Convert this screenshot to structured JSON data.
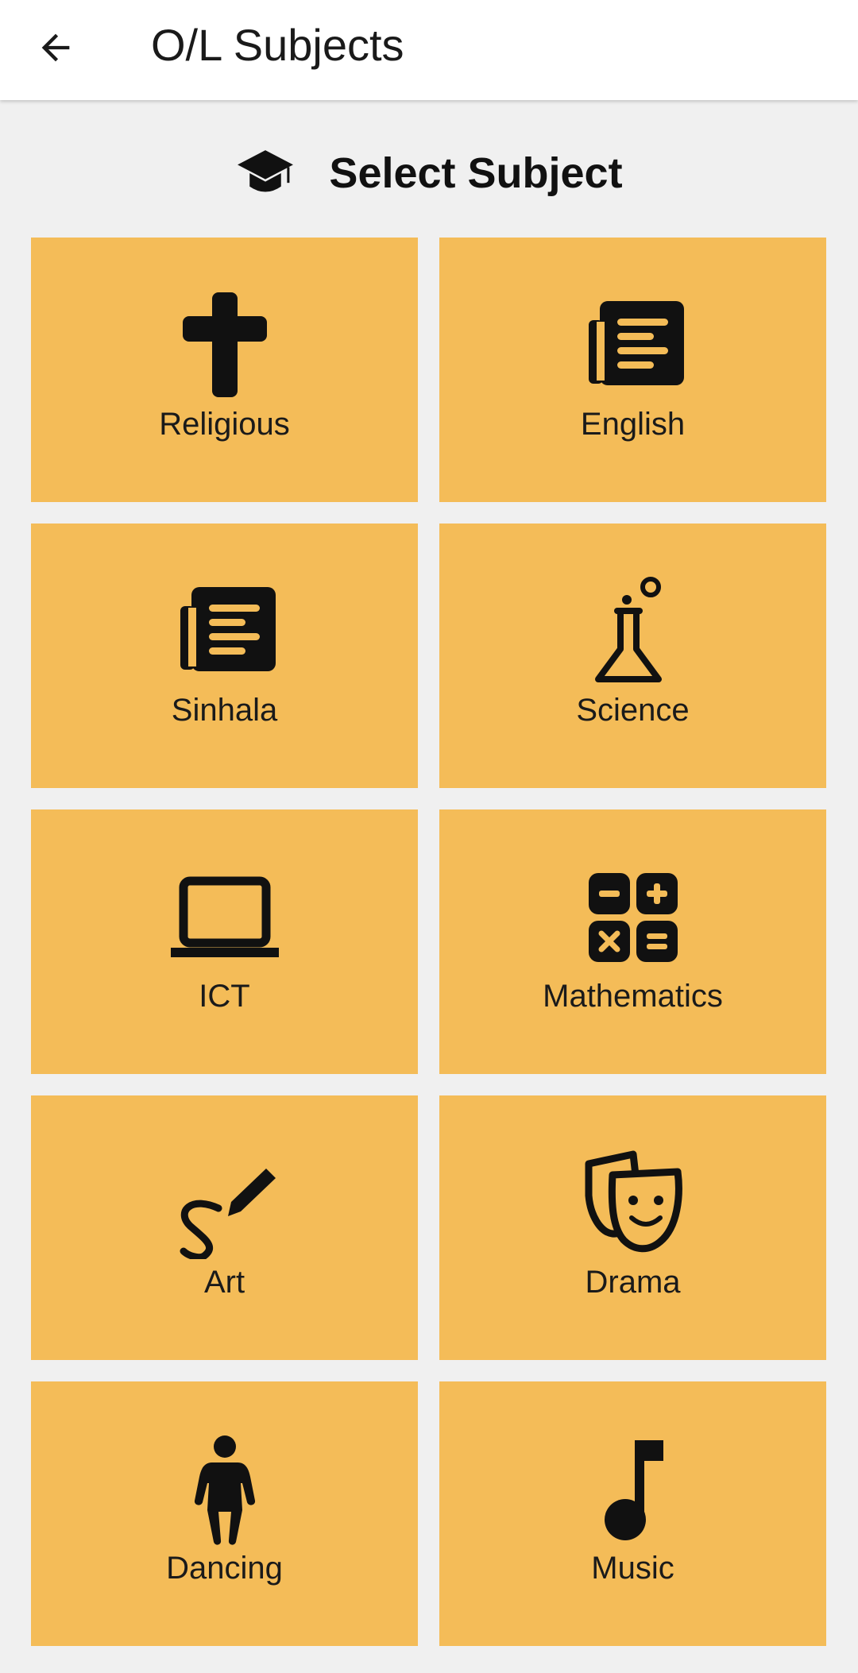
{
  "app_bar": {
    "back_icon": "arrow-left-icon",
    "title": "O/L Subjects"
  },
  "section": {
    "icon": "graduation-cap-icon",
    "title": "Select Subject"
  },
  "colors": {
    "tile_background": "#f4bc58",
    "page_background": "#f0f0f0",
    "app_bar_background": "#ffffff",
    "icon_color": "#111111"
  },
  "subjects": [
    {
      "label": "Religious",
      "icon": "cross-icon"
    },
    {
      "label": "English",
      "icon": "newspaper-icon"
    },
    {
      "label": "Sinhala",
      "icon": "newspaper-icon"
    },
    {
      "label": "Science",
      "icon": "flask-icon"
    },
    {
      "label": "ICT",
      "icon": "laptop-icon"
    },
    {
      "label": "Mathematics",
      "icon": "calculator-icon"
    },
    {
      "label": "Art",
      "icon": "draw-pencil-icon"
    },
    {
      "label": "Drama",
      "icon": "theater-masks-icon"
    },
    {
      "label": "Dancing",
      "icon": "person-icon"
    },
    {
      "label": "Music",
      "icon": "music-note-icon"
    }
  ]
}
